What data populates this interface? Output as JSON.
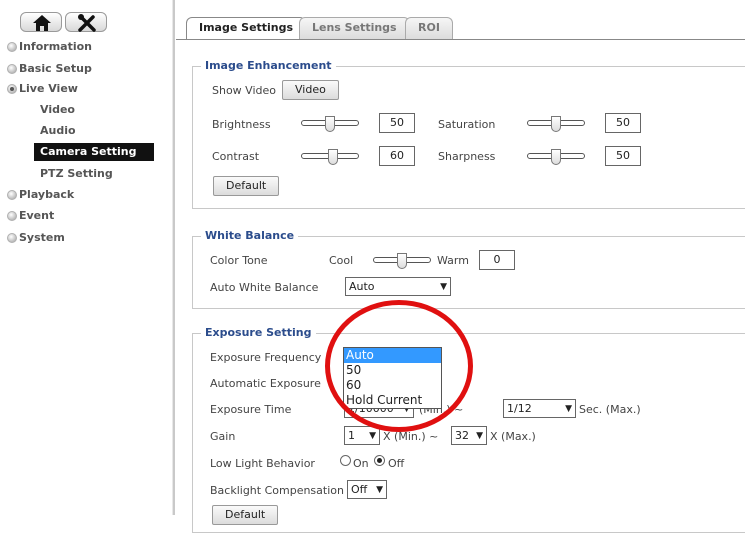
{
  "sidebar": {
    "nav": [
      {
        "label": "Information"
      },
      {
        "label": "Basic Setup"
      },
      {
        "label": "Live View"
      },
      {
        "label": "Video"
      },
      {
        "label": "Audio"
      },
      {
        "label": "Camera Setting"
      },
      {
        "label": "PTZ Setting"
      },
      {
        "label": "Playback"
      },
      {
        "label": "Event"
      },
      {
        "label": "System"
      }
    ],
    "icons": [
      "home-icon",
      "tools-icon"
    ]
  },
  "tabs": [
    {
      "label": "Image Settings",
      "active": true
    },
    {
      "label": "Lens Settings"
    },
    {
      "label": "ROI"
    }
  ],
  "image_enhancement": {
    "legend": "Image Enhancement",
    "show_video_label": "Show Video",
    "video_button": "Video",
    "brightness_label": "Brightness",
    "brightness_value": "50",
    "saturation_label": "Saturation",
    "saturation_value": "50",
    "contrast_label": "Contrast",
    "contrast_value": "60",
    "sharpness_label": "Sharpness",
    "sharpness_value": "50",
    "default_button": "Default"
  },
  "white_balance": {
    "legend": "White Balance",
    "color_tone_label": "Color Tone",
    "cool_label": "Cool",
    "warm_label": "Warm",
    "color_tone_value": "0",
    "awb_label": "Auto White Balance",
    "awb_value": "Auto"
  },
  "exposure": {
    "legend": "Exposure Setting",
    "frequency_label": "Exposure Frequency",
    "frequency_options": [
      "Auto",
      "50",
      "60",
      "Hold Current"
    ],
    "frequency_selected": "Auto",
    "auto_exposure_label": "Automatic Exposure",
    "exposure_time_label": "Exposure Time",
    "exposure_time_min": "1/10000",
    "exposure_min_suffix": "(Min.) ~",
    "exposure_time_max": "1/12",
    "exposure_max_suffix": "Sec.  (Max.)",
    "gain_label": "Gain",
    "gain_min": "1",
    "gain_min_suffix": "X  (Min.) ~",
    "gain_max": "32",
    "gain_max_suffix": "X  (Max.)",
    "low_light_label": "Low Light Behavior",
    "on_label": "On",
    "off_label": "Off",
    "backlight_label": "Backlight Compensation",
    "backlight_value": "Off",
    "default_button": "Default"
  },
  "colors": {
    "accent": "#2b4c8c",
    "highlight_circle": "#e01010",
    "dropdown_selected": "#3399ff"
  }
}
